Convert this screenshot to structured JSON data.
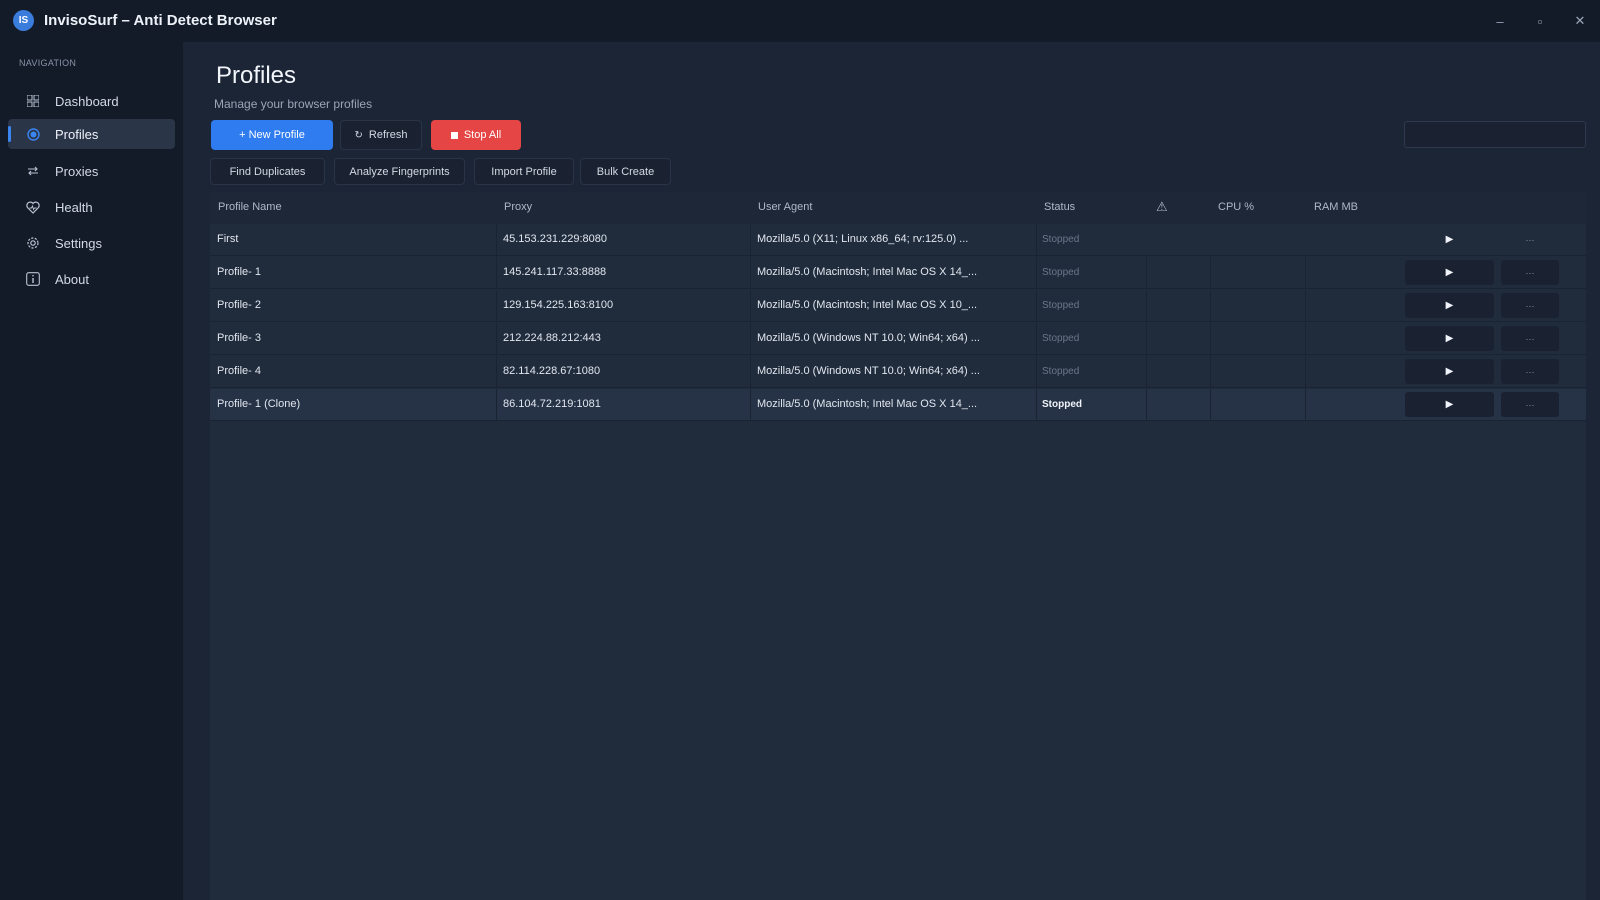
{
  "window": {
    "logo_text": "IS",
    "title": "InvisoSurf – Anti Detect Browser",
    "minimize": "–",
    "maximize": "▫",
    "close": "✕"
  },
  "sidebar": {
    "heading": "NAVIGATION",
    "items": [
      {
        "label": "Dashboard",
        "icon": "grid-icon",
        "active": false
      },
      {
        "label": "Profiles",
        "icon": "profile-dot-icon",
        "active": true
      },
      {
        "label": "Proxies",
        "icon": "swap-arrows-icon",
        "active": false
      },
      {
        "label": "Health",
        "icon": "heart-icon",
        "active": false
      },
      {
        "label": "Settings",
        "icon": "gear-icon",
        "active": false
      },
      {
        "label": "About",
        "icon": "info-icon",
        "active": false
      }
    ]
  },
  "header": {
    "title": "Profiles",
    "subtitle": "Manage your browser profiles"
  },
  "toolbar": {
    "new_profile": "+ New Profile",
    "refresh_icon": "↻",
    "refresh": "Refresh",
    "stop_all": "Stop All",
    "find_duplicates": "Find Duplicates",
    "analyze_fingerprints": "Analyze Fingerprints",
    "import_profile": "Import Profile",
    "bulk_create": "Bulk Create",
    "search_value": ""
  },
  "table": {
    "columns": {
      "name": "Profile Name",
      "proxy": "Proxy",
      "user_agent": "User Agent",
      "status": "Status",
      "warning_icon": "⚠",
      "cpu": "CPU %",
      "ram": "RAM MB"
    },
    "play_glyph": "▶",
    "more_glyph": "···",
    "rows": [
      {
        "name": "First",
        "proxy": "45.153.231.229:8080",
        "user_agent": "Mozilla/5.0 (X11; Linux x86_64; rv:125.0) ...",
        "status": "Stopped"
      },
      {
        "name": "Profile- 1",
        "proxy": "145.241.117.33:8888",
        "user_agent": "Mozilla/5.0 (Macintosh; Intel Mac OS X 14_...",
        "status": "Stopped"
      },
      {
        "name": "Profile- 2",
        "proxy": "129.154.225.163:8100",
        "user_agent": "Mozilla/5.0 (Macintosh; Intel Mac OS X 10_...",
        "status": "Stopped"
      },
      {
        "name": "Profile- 3",
        "proxy": "212.224.88.212:443",
        "user_agent": "Mozilla/5.0 (Windows NT 10.0; Win64; x64) ...",
        "status": "Stopped"
      },
      {
        "name": "Profile- 4",
        "proxy": "82.114.228.67:1080",
        "user_agent": "Mozilla/5.0 (Windows NT 10.0; Win64; x64) ...",
        "status": "Stopped"
      },
      {
        "name": "Profile- 1 (Clone)",
        "proxy": "86.104.72.219:1081",
        "user_agent": "Mozilla/5.0 (Macintosh; Intel Mac OS X 14_...",
        "status": "Stopped"
      }
    ]
  },
  "colors": {
    "accent": "#2f7cf0",
    "danger": "#e64545",
    "background": "#1b2536",
    "sidebar": "#131b29"
  }
}
